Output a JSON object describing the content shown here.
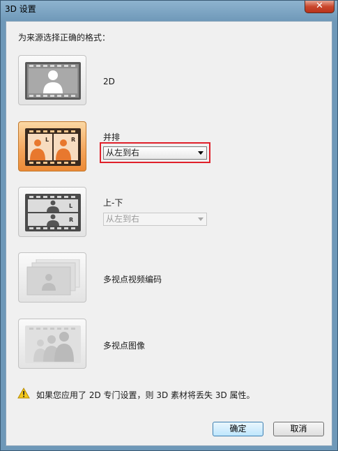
{
  "window": {
    "title": "3D 设置",
    "close_label": "✕"
  },
  "prompt": "为来源选择正确的格式：",
  "options": [
    {
      "label": "2D",
      "icon": "single-view-film-icon",
      "selected": false
    },
    {
      "label": "并排",
      "icon": "side-by-side-film-icon",
      "selected": true,
      "dropdown": {
        "value": "从左到右",
        "enabled": true
      }
    },
    {
      "label": "上-下",
      "icon": "top-bottom-film-icon",
      "selected": false,
      "dropdown": {
        "value": "从左到右",
        "enabled": false
      }
    },
    {
      "label": "多视点视频编码",
      "icon": "multiview-video-icon",
      "selected": false
    },
    {
      "label": "多视点图像",
      "icon": "multiview-image-icon",
      "selected": false
    }
  ],
  "markers": {
    "left": "L",
    "right": "R"
  },
  "warning": "如果您应用了 2D 专门设置，则 3D 素材将丢失 3D 属性。",
  "buttons": {
    "ok": "确定",
    "cancel": "取消"
  },
  "colors": {
    "selected": "#f4a45a",
    "highlight": "#e0202a"
  }
}
